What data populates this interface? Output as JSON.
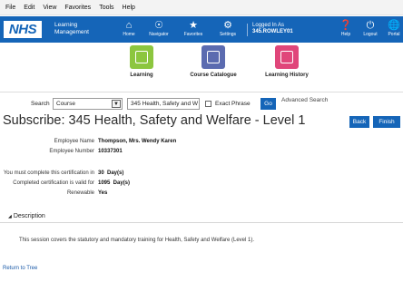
{
  "browser_menu": [
    "File",
    "Edit",
    "View",
    "Favorites",
    "Tools",
    "Help"
  ],
  "header": {
    "logo": "NHS",
    "app_line1": "Learning",
    "app_line2": "Management",
    "nav": [
      {
        "label": "Home",
        "icon": "home-icon"
      },
      {
        "label": "Navigator",
        "icon": "compass-icon"
      },
      {
        "label": "Favorites",
        "icon": "star-icon"
      },
      {
        "label": "Settings",
        "icon": "gear-icon"
      }
    ],
    "logged_in_label": "Logged In As",
    "logged_in_user": "345.ROWLEY01",
    "right_nav": [
      {
        "label": "Help",
        "icon": "help-icon"
      },
      {
        "label": "Logout",
        "icon": "power-icon"
      },
      {
        "label": "Portal",
        "icon": "globe-icon"
      }
    ],
    "bar_color": "#1565b8"
  },
  "tiles": [
    {
      "label": "Learning",
      "color": "#8cc63f"
    },
    {
      "label": "Course Catalogue",
      "color": "#5b6bb0"
    },
    {
      "label": "Learning History",
      "color": "#e0467a"
    }
  ],
  "search": {
    "label": "Search",
    "scope": "Course",
    "query": "345 Health, Safety and W",
    "exact_phrase": "Exact Phrase",
    "go": "Go",
    "advanced": "Advanced Search"
  },
  "page": {
    "title": "Subscribe: 345 Health, Safety and Welfare - Level 1",
    "back": "Back",
    "finish": "Finish"
  },
  "details": {
    "employee_name_label": "Employee Name",
    "employee_name": "Thompson, Mrs. Wendy Karen",
    "employee_number_label": "Employee Number",
    "employee_number": "10337301",
    "complete_label": "You must complete this certification in",
    "complete_value": "30  Day(s)",
    "valid_label": "Completed certification is valid for",
    "valid_value": "1095  Day(s)",
    "renewable_label": "Renewable",
    "renewable_value": "Yes"
  },
  "description": {
    "heading": "Description",
    "text": "This session covers the statutory and mandatory training for Health, Safety and Welfare (Level 1)."
  },
  "return_link": "Return to Tree"
}
